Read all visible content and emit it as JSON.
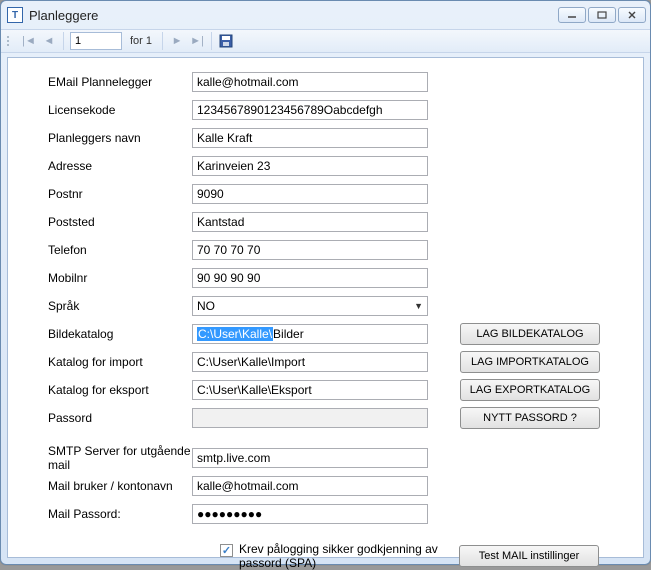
{
  "window": {
    "title": "Planleggere"
  },
  "toolbar": {
    "page_current": "1",
    "page_total": "for 1"
  },
  "labels": {
    "email": "EMail Plannelegger",
    "license": "Licensekode",
    "name": "Planleggers navn",
    "address": "Adresse",
    "postnr": "Postnr",
    "poststed": "Poststed",
    "telefon": "Telefon",
    "mobilnr": "Mobilnr",
    "sprak": "Språk",
    "bildekatalog": "Bildekatalog",
    "import": "Katalog for import",
    "eksport": "Katalog for eksport",
    "passord": "Passord",
    "smtp": "SMTP Server for utgående mail",
    "mailuser": "Mail bruker / kontonavn",
    "mailpass": "Mail Passord:",
    "spa": "Krev pålogging sikker godkjenning av passord (SPA)"
  },
  "values": {
    "email": "kalle@hotmail.com",
    "license": "1234567890123456789Oabcdefgh",
    "name": "Kalle Kraft",
    "address": "Karinveien 23",
    "postnr": "9090",
    "poststed": "Kantstad",
    "telefon": "70 70 70 70",
    "mobilnr": "90 90 90 90",
    "sprak": "NO",
    "bildekatalog_sel": "C:\\User\\Kalle\\",
    "bildekatalog_rest": "Bilder",
    "import": "C:\\User\\Kalle\\Import",
    "eksport": "C:\\User\\Kalle\\Eksport",
    "passord": "",
    "smtp": "smtp.live.com",
    "mailuser": "kalle@hotmail.com",
    "mailpass": "●●●●●●●●●"
  },
  "buttons": {
    "lag_bilde": "LAG BILDEKATALOG",
    "lag_import": "LAG IMPORTKATALOG",
    "lag_export": "LAG EXPORTKATALOG",
    "nytt_passord": "NYTT PASSORD ?",
    "test_mail": "Test MAIL instillinger"
  }
}
